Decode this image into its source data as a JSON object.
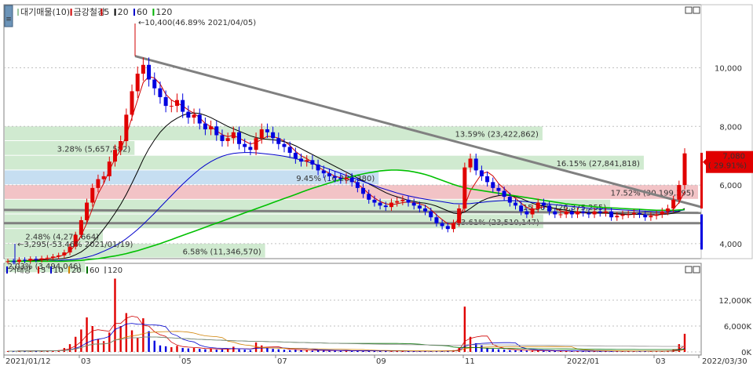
{
  "chart_data": [
    {
      "type": "candlestick",
      "panel": "price",
      "legend": [
        {
          "label": "대기매물(10)",
          "color": "#a0c8a0"
        },
        {
          "label": "금강철강",
          "color": "#d00000"
        },
        {
          "label": "5",
          "color": "#d00000"
        },
        {
          "label": "20",
          "color": "#000000"
        },
        {
          "label": "60",
          "color": "#0000cc"
        },
        {
          "label": "120",
          "color": "#00b000"
        }
      ],
      "ylim": [
        3000,
        11000
      ],
      "y_ticks": [
        {
          "value": 4000,
          "label": "4,000"
        },
        {
          "value": 6000,
          "label": "6,000"
        },
        {
          "value": 8000,
          "label": "8,000"
        },
        {
          "value": 10000,
          "label": "10,000"
        }
      ],
      "x_ticks": [
        "2021/01/12",
        "03",
        "05",
        "07",
        "09",
        "11",
        "2022/01",
        "03",
        "2022/03/30"
      ],
      "price_bars": [
        {
          "lo": 3000,
          "hi": 3500,
          "pct": 0.0203,
          "label": "2.03% (3,494,046)"
        },
        {
          "lo": 3500,
          "hi": 4000,
          "pct": 0.0658,
          "label": "6.58% (11,346,570)"
        },
        {
          "lo": 4000,
          "hi": 4500,
          "pct": 0.0248,
          "label": "2.48% (4,271,664)"
        },
        {
          "lo": 4500,
          "hi": 5000,
          "pct": 0.1361,
          "label": "13.61% (23,510,147)"
        },
        {
          "lo": 5000,
          "hi": 5500,
          "pct": 0.153,
          "label": "15.30% (26,375,255)"
        },
        {
          "lo": 5500,
          "hi": 6000,
          "pct": 0.1752,
          "label": "17.52% (30,199,395)"
        },
        {
          "lo": 6000,
          "hi": 6500,
          "pct": 0.0945,
          "label": "9.45% (16,289,380)"
        },
        {
          "lo": 6500,
          "hi": 7000,
          "pct": 0.1615,
          "label": "16.15% (27,841,818)"
        },
        {
          "lo": 7000,
          "hi": 7500,
          "pct": 0.0328,
          "label": "3.28% (5,657,582)"
        },
        {
          "lo": 7500,
          "hi": 8000,
          "pct": 0.1359,
          "label": "13.59% (23,422,862)"
        }
      ],
      "annotations": [
        {
          "text": "10,400(46.89% 2021/04/05)",
          "price": 10400,
          "month": 2.8
        },
        {
          "text": "3,295(-53.46% 2021/01/19)",
          "price": 3295,
          "month": 0.25
        }
      ],
      "current": {
        "value": "7,080",
        "change": "( 29.91%)"
      },
      "closes": [
        3400,
        3380,
        3450,
        3420,
        3480,
        3450,
        3500,
        3520,
        3560,
        3600,
        3700,
        3900,
        4300,
        4800,
        5400,
        5900,
        6200,
        6300,
        6800,
        7200,
        7500,
        8400,
        9200,
        9800,
        10100,
        9600,
        9300,
        9000,
        8700,
        8700,
        8900,
        8500,
        8300,
        8400,
        8100,
        7900,
        8000,
        7700,
        7500,
        7600,
        7800,
        7400,
        7300,
        7200,
        7600,
        7900,
        7800,
        7600,
        7400,
        7300,
        7100,
        6900,
        6800,
        6850,
        6700,
        6500,
        6400,
        6300,
        6250,
        6200,
        6250,
        6100,
        5900,
        5700,
        5500,
        5400,
        5300,
        5250,
        5400,
        5450,
        5500,
        5400,
        5300,
        5200,
        5100,
        4900,
        4700,
        4600,
        4500,
        4700,
        5200,
        6600,
        6900,
        6500,
        6300,
        6100,
        5900,
        5800,
        5600,
        5400,
        5300,
        5100,
        5000,
        5200,
        5400,
        5300,
        5100,
        5000,
        5000,
        5100,
        5000,
        5100,
        5050,
        5000,
        5100,
        5050,
        5100,
        4900,
        4950,
        5000,
        5000,
        5050,
        5000,
        4900,
        4950,
        5000,
        5100,
        5200,
        5500,
        6000,
        7080
      ],
      "ma": {
        "5": [
          3400,
          3390,
          3410,
          3420,
          3440,
          3450,
          3470,
          3490,
          3520,
          3560,
          3620,
          3740,
          3960,
          4280,
          4700,
          5200,
          5700,
          6050,
          6500,
          6900,
          7200,
          7700,
          8300,
          8900,
          9500,
          9700,
          9650,
          9450,
          9100,
          8900,
          8800,
          8700,
          8560,
          8450,
          8300,
          8100,
          8000,
          7850,
          7720,
          7650,
          7700,
          7600,
          7500,
          7400,
          7450,
          7560,
          7660,
          7650,
          7600,
          7500,
          7350,
          7150,
          7000,
          6900,
          6780,
          6620,
          6500,
          6400,
          6300,
          6250,
          6220,
          6160,
          6040,
          5880,
          5700,
          5560,
          5440,
          5360,
          5330,
          5360,
          5400,
          5420,
          5400,
          5360,
          5300,
          5160,
          4980,
          4820,
          4680,
          4660,
          4840,
          5300,
          5800,
          6100,
          6380,
          6450,
          6310,
          6050,
          5880,
          5700,
          5550,
          5380,
          5240,
          5160,
          5200,
          5260,
          5240,
          5200,
          5120,
          5080,
          5040,
          5060,
          5060,
          5050,
          5050,
          5060,
          5060,
          5030,
          5010,
          5000,
          4990,
          5000,
          5010,
          4990,
          4980,
          4970,
          5000,
          5050,
          5180,
          5400,
          5780
        ],
        "20": [
          3400,
          3400,
          3400,
          3410,
          3420,
          3430,
          3440,
          3450,
          3460,
          3480,
          3500,
          3540,
          3620,
          3720,
          3860,
          4040,
          4260,
          4500,
          4760,
          5040,
          5340,
          5680,
          6060,
          6460,
          6880,
          7240,
          7540,
          7800,
          8000,
          8160,
          8280,
          8380,
          8440,
          8460,
          8440,
          8380,
          8300,
          8200,
          8100,
          8000,
          7920,
          7840,
          7760,
          7680,
          7620,
          7580,
          7560,
          7540,
          7520,
          7480,
          7420,
          7340,
          7240,
          7140,
          7040,
          6940,
          6840,
          6740,
          6640,
          6540,
          6440,
          6340,
          6240,
          6140,
          6040,
          5940,
          5840,
          5740,
          5660,
          5600,
          5540,
          5480,
          5440,
          5400,
          5380,
          5340,
          5280,
          5200,
          5120,
          5040,
          5020,
          5080,
          5200,
          5340,
          5460,
          5540,
          5600,
          5640,
          5660,
          5640,
          5600,
          5540,
          5460,
          5380,
          5320,
          5280,
          5240,
          5200,
          5170,
          5140,
          5110,
          5090,
          5070,
          5060,
          5050,
          5040,
          5040,
          5030,
          5020,
          5010,
          5000,
          5000,
          5000,
          4990,
          4990,
          4990,
          5000,
          5010,
          5040,
          5100,
          5200
        ],
        "60": [
          3400,
          3400,
          3400,
          3400,
          3400,
          3400,
          3400,
          3410,
          3420,
          3430,
          3440,
          3450,
          3470,
          3500,
          3540,
          3590,
          3660,
          3740,
          3830,
          3930,
          4040,
          4170,
          4320,
          4480,
          4660,
          4850,
          5040,
          5240,
          5440,
          5640,
          5840,
          6030,
          6210,
          6380,
          6540,
          6680,
          6800,
          6900,
          6980,
          7040,
          7080,
          7100,
          7110,
          7110,
          7100,
          7080,
          7060,
          7040,
          7010,
          6980,
          6940,
          6900,
          6850,
          6800,
          6740,
          6680,
          6610,
          6540,
          6470,
          6400,
          6330,
          6260,
          6190,
          6120,
          6050,
          5980,
          5910,
          5850,
          5790,
          5730,
          5680,
          5630,
          5590,
          5550,
          5520,
          5490,
          5460,
          5430,
          5400,
          5370,
          5360,
          5360,
          5370,
          5390,
          5410,
          5430,
          5450,
          5460,
          5470,
          5470,
          5460,
          5450,
          5430,
          5410,
          5390,
          5370,
          5350,
          5330,
          5310,
          5290,
          5270,
          5250,
          5230,
          5210,
          5200,
          5190,
          5180,
          5170,
          5160,
          5150,
          5140,
          5130,
          5120,
          5110,
          5100,
          5090,
          5090,
          5090,
          5100,
          5120,
          5150
        ],
        "120": [
          3400,
          3400,
          3400,
          3400,
          3400,
          3400,
          3400,
          3400,
          3400,
          3400,
          3400,
          3410,
          3420,
          3430,
          3450,
          3470,
          3490,
          3520,
          3550,
          3580,
          3620,
          3660,
          3710,
          3760,
          3820,
          3880,
          3940,
          4000,
          4070,
          4140,
          4210,
          4280,
          4350,
          4420,
          4490,
          4560,
          4630,
          4700,
          4770,
          4840,
          4910,
          4980,
          5050,
          5120,
          5190,
          5260,
          5330,
          5400,
          5470,
          5540,
          5610,
          5680,
          5750,
          5820,
          5890,
          5950,
          6010,
          6070,
          6130,
          6190,
          6240,
          6290,
          6340,
          6380,
          6420,
          6450,
          6480,
          6500,
          6510,
          6510,
          6500,
          6480,
          6450,
          6410,
          6360,
          6300,
          6230,
          6160,
          6090,
          6020,
          5960,
          5910,
          5870,
          5840,
          5810,
          5780,
          5750,
          5720,
          5690,
          5660,
          5630,
          5600,
          5570,
          5540,
          5510,
          5480,
          5450,
          5420,
          5390,
          5360,
          5340,
          5320,
          5300,
          5280,
          5260,
          5240,
          5230,
          5220,
          5210,
          5200,
          5190,
          5180,
          5170,
          5160,
          5150,
          5140,
          5140,
          5140,
          5140,
          5150,
          5160
        ]
      }
    },
    {
      "type": "bar",
      "panel": "volume",
      "legend": [
        {
          "label": "거래량",
          "color": "#000000"
        },
        {
          "label": "5",
          "color": "#d00000"
        },
        {
          "label": "10",
          "color": "#0000cc"
        },
        {
          "label": "20",
          "color": "#d08000"
        },
        {
          "label": "60",
          "color": "#007000"
        },
        {
          "label": "120",
          "color": "#909090"
        }
      ],
      "ylim": [
        0,
        18000
      ],
      "y_ticks": [
        {
          "value": 0,
          "label": "0K"
        },
        {
          "value": 6000,
          "label": "6,000K"
        },
        {
          "value": 12000,
          "label": "12,000K"
        }
      ],
      "volumes": [
        200,
        150,
        300,
        250,
        220,
        260,
        300,
        280,
        350,
        400,
        900,
        1800,
        3500,
        5200,
        8000,
        6000,
        3000,
        2500,
        4500,
        17000,
        6000,
        9000,
        5000,
        3200,
        7800,
        4800,
        2600,
        1500,
        1300,
        1100,
        1400,
        900,
        800,
        900,
        700,
        600,
        800,
        500,
        600,
        700,
        1200,
        600,
        500,
        400,
        2200,
        1500,
        900,
        700,
        600,
        500,
        400,
        500,
        400,
        350,
        300,
        350,
        300,
        250,
        300,
        250,
        200,
        300,
        250,
        200,
        200,
        250,
        300,
        220,
        200,
        180,
        200,
        180,
        160,
        200,
        180,
        220,
        200,
        250,
        300,
        400,
        900,
        10500,
        3500,
        2000,
        1500,
        900,
        700,
        600,
        500,
        400,
        350,
        400,
        300,
        250,
        300,
        250,
        220,
        200,
        200,
        180,
        200,
        180,
        200,
        180,
        160,
        180,
        200,
        180,
        160,
        150,
        160,
        180,
        200,
        170,
        160,
        150,
        180,
        300,
        600,
        1800,
        4200
      ]
    }
  ]
}
